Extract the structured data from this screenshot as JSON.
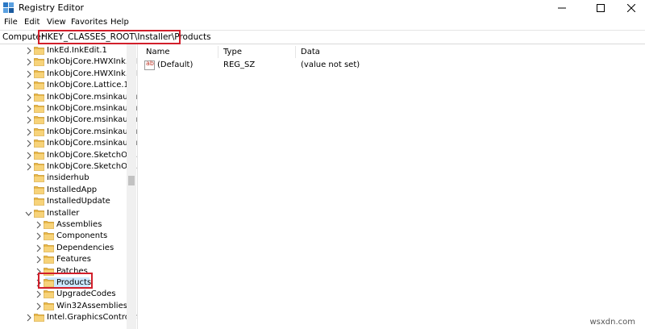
{
  "window": {
    "title": "Registry Editor",
    "icon": "registry-editor-icon"
  },
  "menu": {
    "items": [
      "File",
      "Edit",
      "View",
      "Favorites",
      "Help"
    ]
  },
  "address": {
    "prefix": "Computer",
    "path": "HKEY_CLASSES_ROOT\\Installer\\Products"
  },
  "tree": {
    "items": [
      {
        "label": "InkEd.InkEdit.1",
        "expandable": true
      },
      {
        "label": "InkObjCore.HWXInk.E-I",
        "expandable": true
      },
      {
        "label": "InkObjCore.HWXInk.E-I",
        "expandable": true
      },
      {
        "label": "InkObjCore.Lattice.1",
        "expandable": true
      },
      {
        "label": "InkObjCore.msinkaut.In",
        "expandable": true
      },
      {
        "label": "InkObjCore.msinkaut.In",
        "expandable": true
      },
      {
        "label": "InkObjCore.msinkaut.In",
        "expandable": true
      },
      {
        "label": "InkObjCore.msinkaut.In",
        "expandable": true
      },
      {
        "label": "InkObjCore.msinkaut.In",
        "expandable": true
      },
      {
        "label": "InkObjCore.SketchObj.S",
        "expandable": true
      },
      {
        "label": "InkObjCore.SketchObj.S",
        "expandable": true
      },
      {
        "label": "insiderhub",
        "expandable": false
      },
      {
        "label": "InstalledApp",
        "expandable": false
      },
      {
        "label": "InstalledUpdate",
        "expandable": false
      },
      {
        "label": "Installer",
        "expandable": true,
        "expanded": true
      },
      {
        "label": "Assemblies",
        "expandable": true
      },
      {
        "label": "Components",
        "expandable": true
      },
      {
        "label": "Dependencies",
        "expandable": true
      },
      {
        "label": "Features",
        "expandable": true
      },
      {
        "label": "Patches",
        "expandable": true
      },
      {
        "label": "Products",
        "expandable": true,
        "selected": true
      },
      {
        "label": "UpgradeCodes",
        "expandable": true
      },
      {
        "label": "Win32Assemblies",
        "expandable": true
      },
      {
        "label": "Intel.GraphicsControlPa",
        "expandable": true
      }
    ]
  },
  "list": {
    "columns": [
      "Name",
      "Type",
      "Data"
    ],
    "rows": [
      {
        "name": "(Default)",
        "type": "REG_SZ",
        "data": "(value not set)",
        "icon": "string-value-icon"
      }
    ]
  },
  "watermark": "wsxdn.com",
  "colors": {
    "highlight_border": "#d21f2b",
    "selection": "#cce8ff",
    "folder": "#e8b84a"
  }
}
